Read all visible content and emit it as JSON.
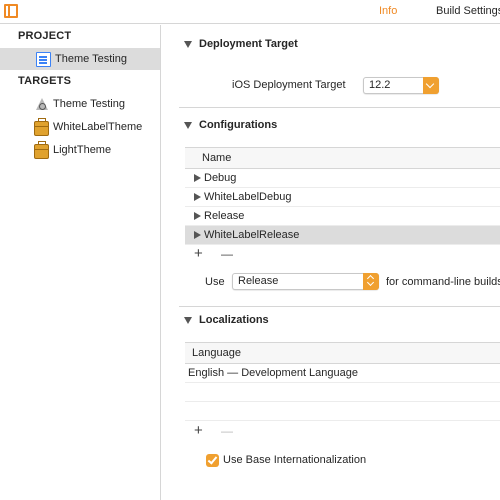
{
  "tabs": {
    "info": "Info",
    "build_settings": "Build Settings"
  },
  "sidebar": {
    "project_header": "PROJECT",
    "project_item": "Theme Testing",
    "targets_header": "TARGETS",
    "targets": [
      "Theme Testing",
      "WhiteLabelTheme",
      "LightTheme"
    ]
  },
  "deployment": {
    "title": "Deployment Target",
    "label": "iOS Deployment Target",
    "value": "12.2"
  },
  "configurations": {
    "title": "Configurations",
    "column": "Name",
    "rows": [
      "Debug",
      "WhiteLabelDebug",
      "Release",
      "WhiteLabelRelease"
    ],
    "selected_index": 3,
    "use_label": "Use",
    "use_value": "Release",
    "use_suffix": "for command-line builds"
  },
  "localizations": {
    "title": "Localizations",
    "column": "Language",
    "rows": [
      "English — Development Language"
    ],
    "base_internationalization_label": "Use Base Internationalization",
    "base_internationalization_checked": true
  },
  "controls": {
    "add": "+",
    "remove": "—"
  },
  "colors": {
    "accent": "#f08a24",
    "selection": "#dcdcdc",
    "project_icon": "#3b82f6",
    "target_icon": "#e0a22e"
  }
}
